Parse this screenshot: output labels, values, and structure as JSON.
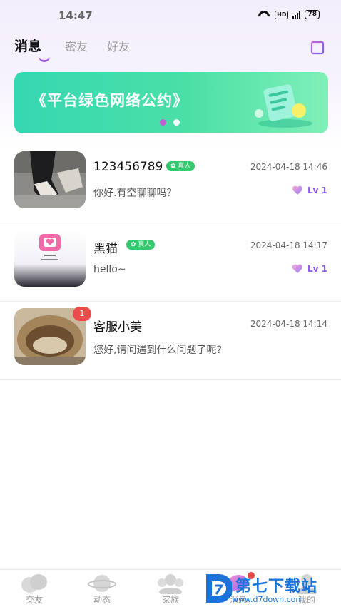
{
  "status_bar": {
    "time": "14:47",
    "network": "HD",
    "signal": "4G",
    "battery": "78"
  },
  "tabs": [
    {
      "label": "消息",
      "active": true
    },
    {
      "label": "密友",
      "active": false
    },
    {
      "label": "好友",
      "active": false
    }
  ],
  "banner": {
    "title": "《平台绿色网络公约》",
    "dot_count": 2,
    "active_dot": 0
  },
  "conversations": [
    {
      "name": "123456789",
      "verified_label": "真人",
      "time": "2024-04-18 14:46",
      "message": "你好.有空聊聊吗？",
      "level": "Lv 1",
      "unread": ""
    },
    {
      "name": "黑猫",
      "verified_label": "真人",
      "time": "2024-04-18 14:17",
      "message": "hello~",
      "level": "Lv 1",
      "unread": ""
    },
    {
      "name": "客服小美",
      "verified_label": "",
      "time": "2024-04-18 14:14",
      "message": "您好,请问遇到什么问题了呢?",
      "level": "",
      "unread": "1"
    }
  ],
  "bottom_nav": [
    {
      "label": "交友",
      "icon": "friends-icon"
    },
    {
      "label": "动态",
      "icon": "planet-icon"
    },
    {
      "label": "家族",
      "icon": "family-icon"
    },
    {
      "label": "消息",
      "icon": "message-icon"
    },
    {
      "label": "我的",
      "icon": "profile-icon"
    }
  ],
  "watermark": {
    "text": "第七下载站",
    "url": "www.d7down.com"
  },
  "colors": {
    "accent": "#a25ae6",
    "banner": "#35d8b2",
    "verified": "#35c96e",
    "badge": "#ea4b4b"
  }
}
